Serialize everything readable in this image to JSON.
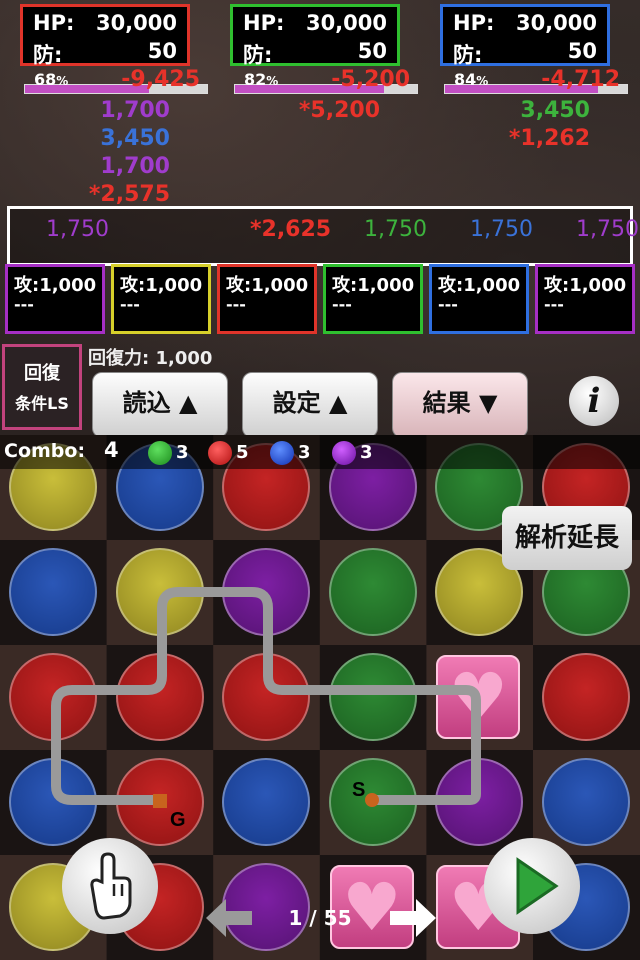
{
  "enemies": [
    {
      "hp_label": "HP:",
      "hp": "30,000",
      "def_label": "防:",
      "def": "50",
      "pct": "68",
      "pct_unit": "%",
      "dmg": "-9,425",
      "color": "#e0342a"
    },
    {
      "hp_label": "HP:",
      "hp": "30,000",
      "def_label": "防:",
      "def": "50",
      "pct": "82",
      "pct_unit": "%",
      "dmg": "-5,200",
      "color": "#2fbf2f"
    },
    {
      "hp_label": "HP:",
      "hp": "30,000",
      "def_label": "防:",
      "def": "50",
      "pct": "84",
      "pct_unit": "%",
      "dmg": "-4,712",
      "color": "#2f6fe0"
    }
  ],
  "enemy_hits": {
    "e1": [
      "1,700",
      "3,450",
      "1,700",
      "*2,575"
    ],
    "e2": [
      "*5,200"
    ],
    "e3": [
      "3,450",
      "*1,262"
    ]
  },
  "team_damage": [
    "1,750",
    "*2,625",
    "1,750",
    "1,750",
    "1,750"
  ],
  "attackers": [
    {
      "label": "攻:1,000",
      "sub": "---",
      "color": "#a62fc4"
    },
    {
      "label": "攻:1,000",
      "sub": "---",
      "color": "#d6cf2a"
    },
    {
      "label": "攻:1,000",
      "sub": "---",
      "color": "#e0342a"
    },
    {
      "label": "攻:1,000",
      "sub": "---",
      "color": "#2fbf2f"
    },
    {
      "label": "攻:1,000",
      "sub": "---",
      "color": "#2f6fe0"
    },
    {
      "label": "攻:1,000",
      "sub": "---",
      "color": "#a62fc4"
    }
  ],
  "recovery": {
    "btn_line1": "回復",
    "btn_line2": "条件LS",
    "label": "回復力:",
    "value": "1,000"
  },
  "toolbar": {
    "load": "読込 ▲",
    "settings": "設定 ▲",
    "result": "結果 ▼",
    "info": "i"
  },
  "combo": {
    "label": "Combo:",
    "count": "4",
    "green": "3",
    "red": "5",
    "blue": "3",
    "purple": "3"
  },
  "extend_btn": "解析延長",
  "path_markers": {
    "start": "S",
    "goal": "G"
  },
  "page": {
    "current": "1",
    "total": "55",
    "text": "1 / 55"
  },
  "board": [
    [
      "yellow",
      "blue",
      "red",
      "purple",
      "green",
      "red"
    ],
    [
      "blue",
      "yellow",
      "purple",
      "green",
      "yellow",
      "green"
    ],
    [
      "red",
      "red",
      "red",
      "green",
      "heart",
      "red"
    ],
    [
      "blue",
      "red",
      "blue",
      "green",
      "purple",
      "blue"
    ],
    [
      "yellow",
      "red",
      "purple",
      "heart",
      "heart",
      "blue"
    ]
  ]
}
